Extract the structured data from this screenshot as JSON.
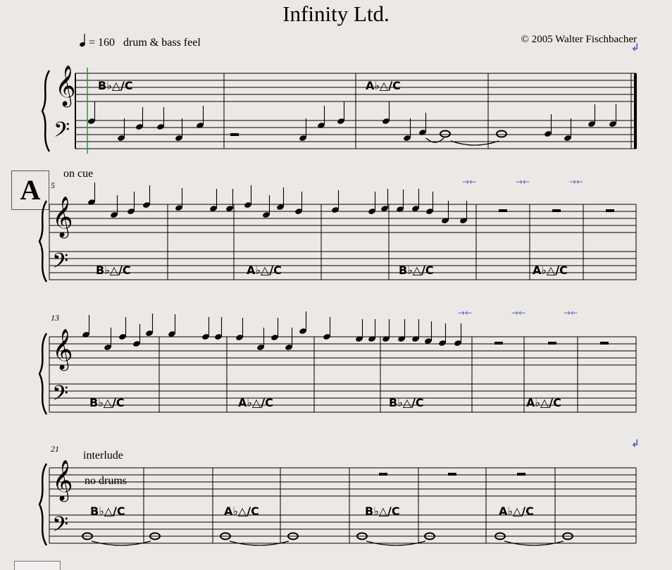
{
  "header": {
    "title": "Infinity Ltd.",
    "tempo_value": "= 160",
    "feel": "drum & bass feel",
    "copyright": "© 2005 Walter Fischbacher"
  },
  "rehearsal_mark": "A",
  "text_marks": {
    "on_cue": "on cue",
    "interlude": "interlude",
    "no_drums": "no drums"
  },
  "measure_numbers": {
    "system2": "5",
    "system3": "13",
    "system4": "21"
  },
  "chords": {
    "bb_maj": "B♭△/C",
    "ab_maj": "A♭△/C"
  },
  "colors": {
    "ink": "#000000",
    "paper": "#ece8e6",
    "cursor_line": "#1e9a3c",
    "marker_blue": "#5a63c8"
  },
  "icons": {
    "return": "return-arrow-icon",
    "tempo_note": "quarter-note-icon",
    "marker": "double-arrow-marker-icon"
  }
}
